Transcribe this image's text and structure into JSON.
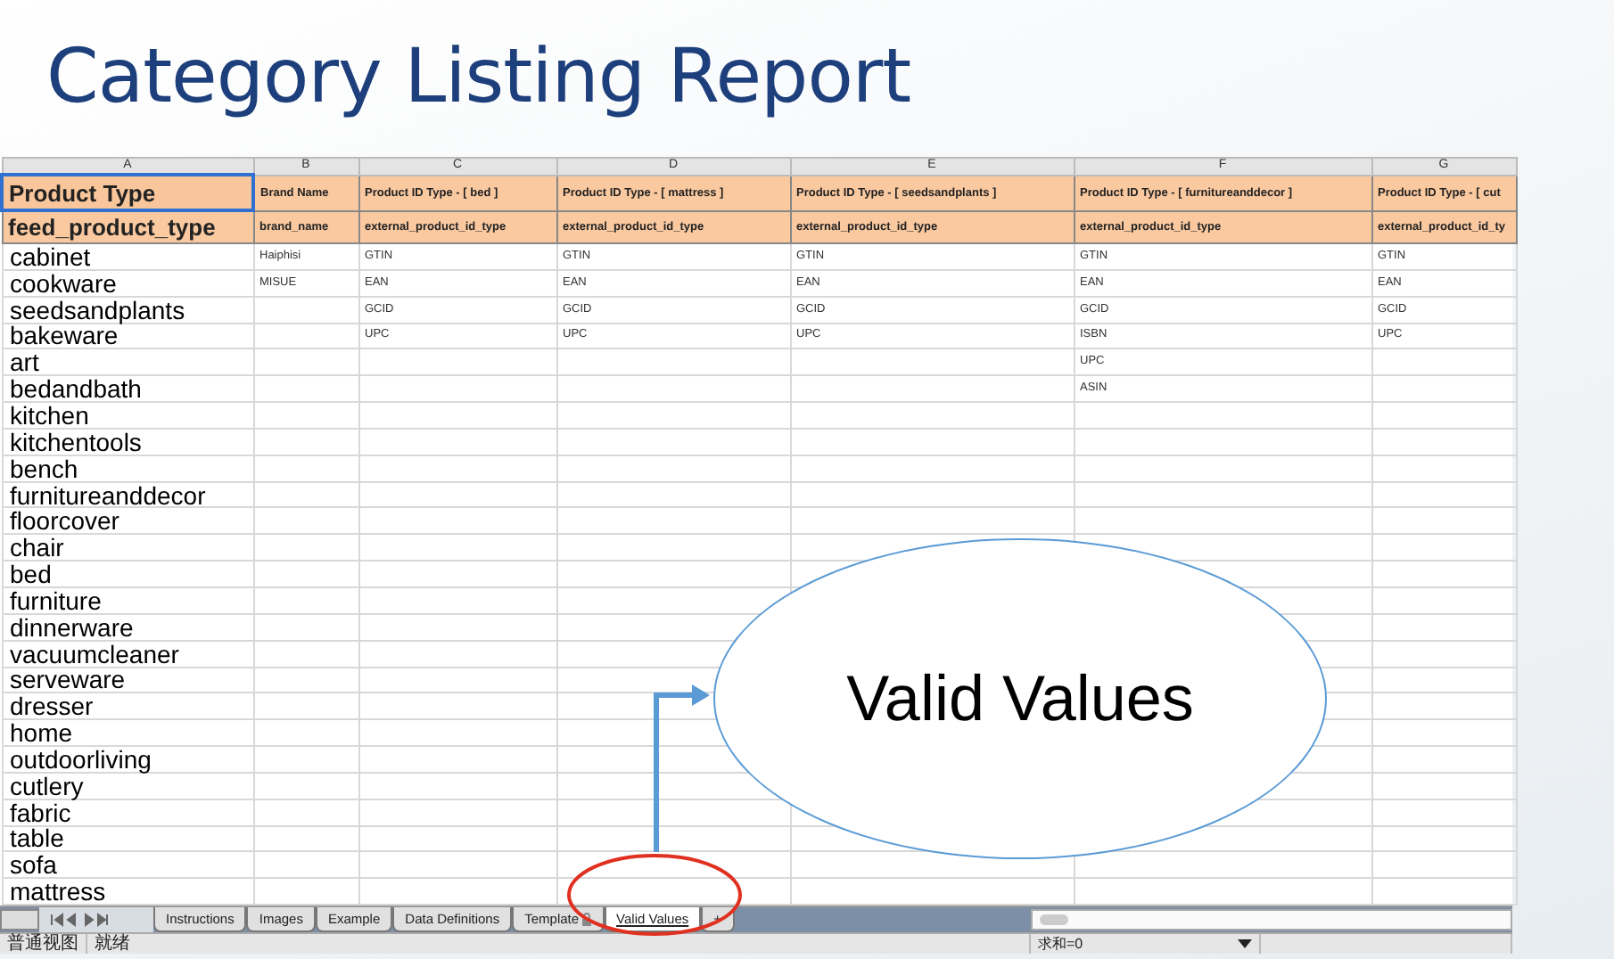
{
  "title": "Category Listing Report",
  "sheet": {
    "columns": [
      {
        "letter": "A",
        "header": "Product Type",
        "field": "feed_product_type",
        "selected": true
      },
      {
        "letter": "B",
        "header": "Brand Name",
        "field": "brand_name",
        "selected": false
      },
      {
        "letter": "C",
        "header": "Product ID Type - [ bed ]",
        "field": "external_product_id_type",
        "selected": false
      },
      {
        "letter": "D",
        "header": "Product ID Type - [ mattress ]",
        "field": "external_product_id_type",
        "selected": false
      },
      {
        "letter": "E",
        "header": "Product ID Type - [ seedsandplants ]",
        "field": "external_product_id_type",
        "selected": false
      },
      {
        "letter": "F",
        "header": "Product ID Type - [ furnitureanddecor ]",
        "field": "external_product_id_type",
        "selected": false
      },
      {
        "letter": "G",
        "header": "Product ID Type - [ cut",
        "field": "external_product_id_ty",
        "selected": false
      }
    ],
    "rows": [
      {
        "product_type": "cabinet",
        "brand_name": "Haiphisi",
        "bed": "GTIN",
        "mattress": "GTIN",
        "seedsandplants": "GTIN",
        "furnitureanddecor": "GTIN",
        "column_g": "GTIN"
      },
      {
        "product_type": "cookware",
        "brand_name": "MISUE",
        "bed": "EAN",
        "mattress": "EAN",
        "seedsandplants": "EAN",
        "furnitureanddecor": "EAN",
        "column_g": "EAN"
      },
      {
        "product_type": "seedsandplants",
        "bed": "GCID",
        "mattress": "GCID",
        "seedsandplants": "GCID",
        "furnitureanddecor": "GCID",
        "column_g": "GCID"
      },
      {
        "product_type": "bakeware",
        "bed": "UPC",
        "mattress": "UPC",
        "seedsandplants": "UPC",
        "furnitureanddecor": "ISBN",
        "column_g": "UPC"
      },
      {
        "product_type": "art",
        "furnitureanddecor": "UPC"
      },
      {
        "product_type": "bedandbath",
        "furnitureanddecor": "ASIN"
      },
      {
        "product_type": "kitchen"
      },
      {
        "product_type": "kitchentools"
      },
      {
        "product_type": "bench"
      },
      {
        "product_type": "furnitureanddecor"
      },
      {
        "product_type": "floorcover"
      },
      {
        "product_type": "chair"
      },
      {
        "product_type": "bed"
      },
      {
        "product_type": "furniture"
      },
      {
        "product_type": "dinnerware"
      },
      {
        "product_type": "vacuumcleaner"
      },
      {
        "product_type": "serveware"
      },
      {
        "product_type": "dresser"
      },
      {
        "product_type": "home"
      },
      {
        "product_type": "outdoorliving"
      },
      {
        "product_type": "cutlery"
      },
      {
        "product_type": "fabric"
      },
      {
        "product_type": "table"
      },
      {
        "product_type": "sofa"
      },
      {
        "product_type": "mattress"
      }
    ],
    "tabs": [
      {
        "label": "Instructions",
        "selected": false,
        "locked": false
      },
      {
        "label": "Images",
        "selected": false,
        "locked": false
      },
      {
        "label": "Example",
        "selected": false,
        "locked": false
      },
      {
        "label": "Data Definitions",
        "selected": false,
        "locked": false
      },
      {
        "label": "Template",
        "selected": false,
        "locked": true
      },
      {
        "label": "Valid Values",
        "selected": true,
        "locked": false
      }
    ],
    "add_tab": "+",
    "status_bar": {
      "view": "普通视图",
      "state": "就绪",
      "sum": "求和=0"
    }
  },
  "callout": {
    "label": "Valid Values"
  }
}
